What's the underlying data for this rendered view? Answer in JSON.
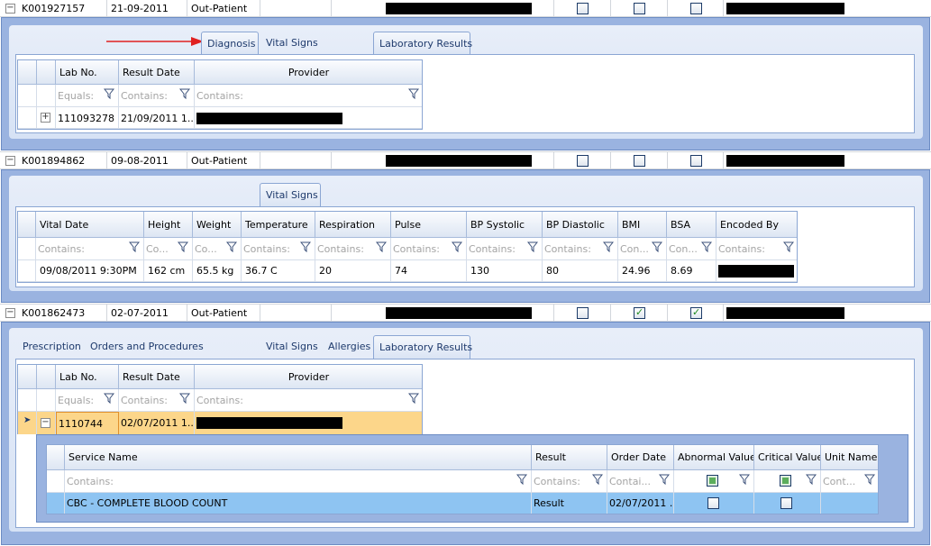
{
  "rows": [
    {
      "id": "K001927157",
      "date": "21-09-2011",
      "type": "Out-Patient",
      "checks": [
        false,
        false,
        false
      ]
    },
    {
      "id": "K001894862",
      "date": "09-08-2011",
      "type": "Out-Patient",
      "checks": [
        false,
        false,
        false
      ]
    },
    {
      "id": "K001862473",
      "date": "02-07-2011",
      "type": "Out-Patient",
      "checks": [
        false,
        true,
        true
      ]
    }
  ],
  "panel1": {
    "tabs": [
      "Diagnosis",
      "Vital Signs",
      "Laboratory Results"
    ],
    "headers": [
      "Lab No.",
      "Result Date",
      "Provider"
    ],
    "filters": [
      "Equals:",
      "Contains:",
      "Contains:"
    ],
    "row": {
      "lab_no": "111093278",
      "result_date": "21/09/2011  1..."
    }
  },
  "panel2": {
    "tabs": [
      "Vital Signs"
    ],
    "headers": [
      "Vital Date",
      "Height",
      "Weight",
      "Temperature",
      "Respiration",
      "Pulse",
      "BP Systolic",
      "BP Diastolic",
      "BMI",
      "BSA",
      "Encoded By"
    ],
    "filters": [
      "Contains:",
      "Co...",
      "Co...",
      "Contains:",
      "Contains:",
      "Contains:",
      "Contains:",
      "Contains:",
      "Con...",
      "Con...",
      "Contains:"
    ],
    "row": [
      "09/08/2011  9:30PM",
      "162 cm",
      "65.5 kg",
      "36.7 C",
      "20",
      "74",
      "130",
      "80",
      "24.96",
      "8.69"
    ]
  },
  "panel3": {
    "tabs": [
      "Prescription",
      "Orders and Procedures",
      "Vital Signs",
      "Allergies",
      "Laboratory Results"
    ],
    "headers": [
      "Lab No.",
      "Result Date",
      "Provider"
    ],
    "filters": [
      "Equals:",
      "Contains:",
      "Contains:"
    ],
    "row": {
      "lab_no": "1110744",
      "result_date": "02/07/2011  1..."
    },
    "sub": {
      "headers": [
        "Service Name",
        "Result",
        "Order Date",
        "Abnormal Value",
        "Critical Value",
        "Unit Name"
      ],
      "filters": [
        "Contains:",
        "Contains:",
        "Contai...",
        "",
        "",
        "Cont..."
      ],
      "row": {
        "service": "CBC - COMPLETE BLOOD COUNT",
        "result": "Result",
        "order_date": "02/07/2011 ..."
      }
    }
  },
  "colors": {
    "panel": "#9ab3e0",
    "selected_row": "#fcd68a",
    "sub_selected": "#8ec4f2",
    "arrow": "#e02020"
  }
}
